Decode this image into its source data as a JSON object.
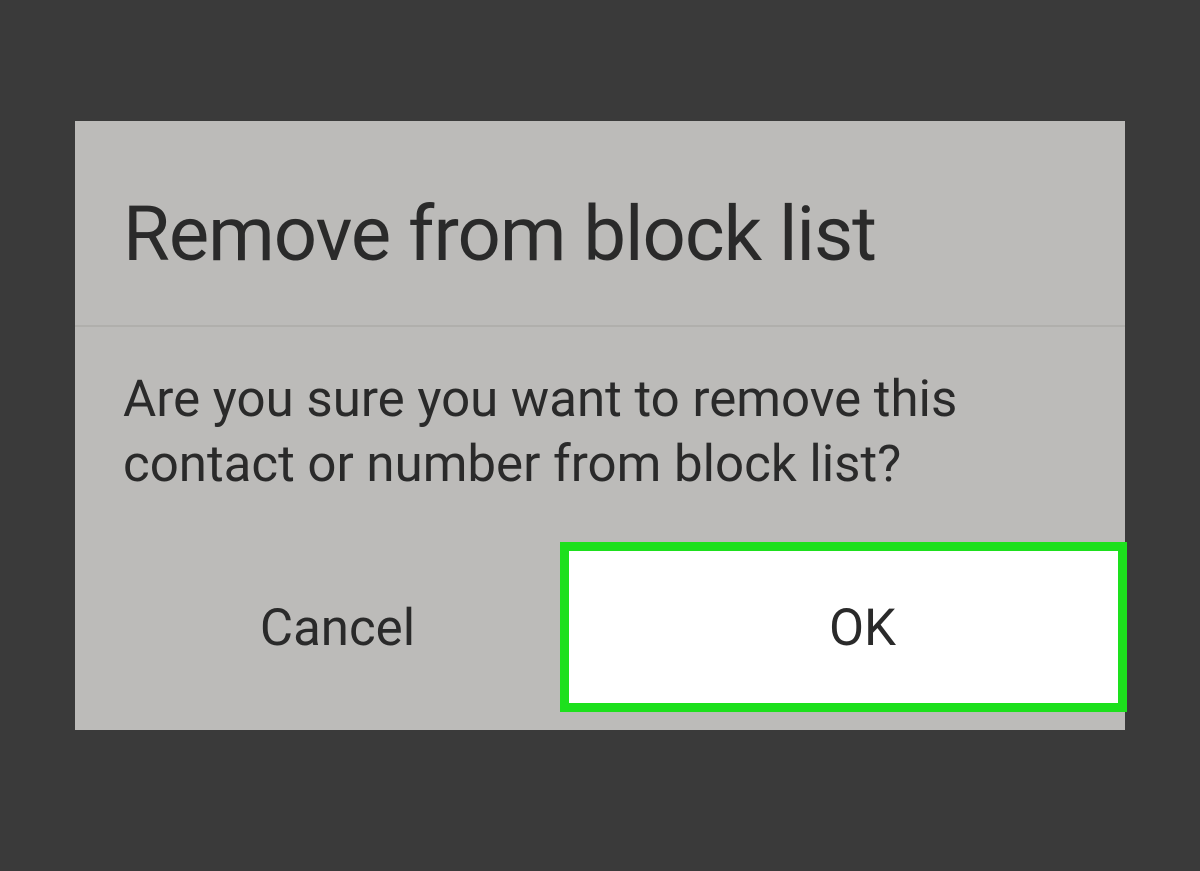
{
  "dialog": {
    "title": "Remove from block list",
    "message": "Are you sure you want to remove this contact or number from block list?",
    "cancel_label": "Cancel",
    "ok_label": "OK"
  }
}
